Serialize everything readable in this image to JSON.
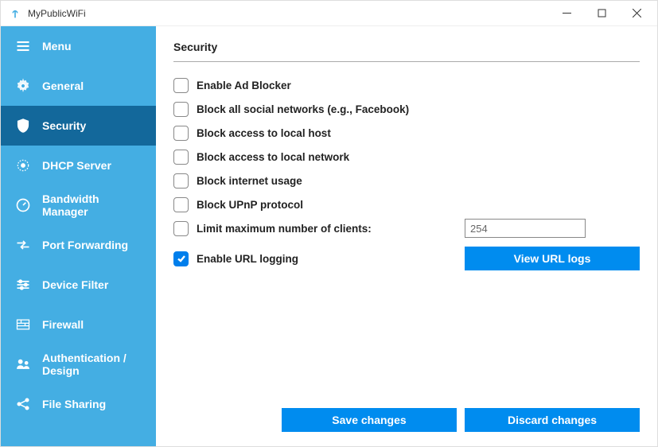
{
  "app": {
    "title": "MyPublicWiFi"
  },
  "sidebar": {
    "items": [
      {
        "label": "Menu",
        "icon": "menu-icon"
      },
      {
        "label": "General",
        "icon": "gear-icon"
      },
      {
        "label": "Security",
        "icon": "shield-icon"
      },
      {
        "label": "DHCP Server",
        "icon": "dhcp-icon"
      },
      {
        "label": "Bandwidth Manager",
        "icon": "gauge-icon"
      },
      {
        "label": "Port Forwarding",
        "icon": "port-icon"
      },
      {
        "label": "Device Filter",
        "icon": "filter-icon"
      },
      {
        "label": "Firewall",
        "icon": "firewall-icon"
      },
      {
        "label": "Authentication / Design",
        "icon": "auth-icon"
      },
      {
        "label": "File Sharing",
        "icon": "share-icon"
      }
    ],
    "active_index": 2
  },
  "security": {
    "heading": "Security",
    "options": [
      {
        "label": "Enable Ad Blocker",
        "checked": false
      },
      {
        "label": "Block all social networks (e.g., Facebook)",
        "checked": false
      },
      {
        "label": "Block access to local host",
        "checked": false
      },
      {
        "label": "Block access to local network",
        "checked": false
      },
      {
        "label": "Block internet usage",
        "checked": false
      },
      {
        "label": "Block UPnP protocol",
        "checked": false
      }
    ],
    "limit_clients": {
      "label": "Limit maximum number of clients:",
      "checked": false,
      "value": "254"
    },
    "url_logging": {
      "label": "Enable URL logging",
      "checked": true,
      "button": "View URL logs"
    },
    "save_btn": "Save changes",
    "discard_btn": "Discard changes"
  }
}
